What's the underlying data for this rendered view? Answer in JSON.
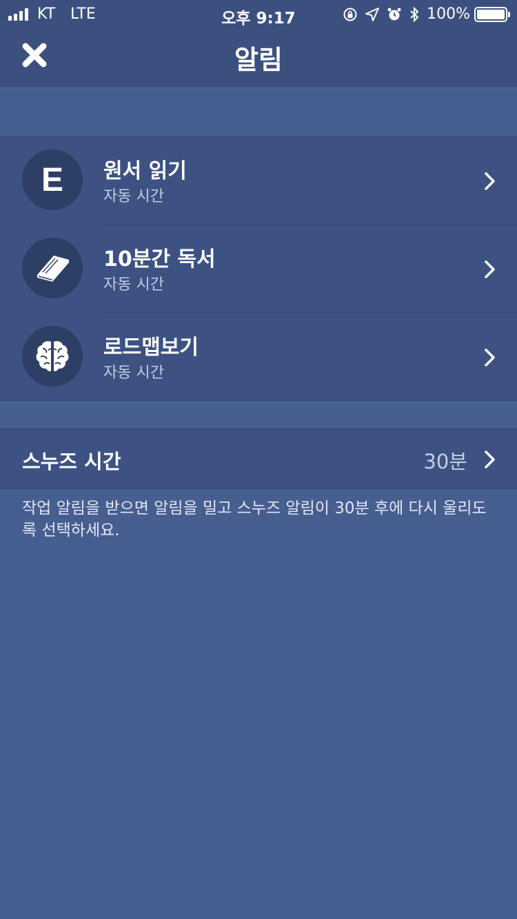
{
  "status_bar": {
    "carrier": "KT",
    "network": "LTE",
    "time": "오후 9:17",
    "battery": "100%"
  },
  "header": {
    "title": "알림"
  },
  "reminders": [
    {
      "title": "원서 읽기",
      "subtitle": "자동 시간",
      "icon": "letter-e-icon",
      "icon_text": "E"
    },
    {
      "title": "10분간 독서",
      "subtitle": "자동 시간",
      "icon": "book-icon"
    },
    {
      "title": "로드맵보기",
      "subtitle": "자동 시간",
      "icon": "brain-icon"
    }
  ],
  "snooze": {
    "label": "스누즈 시간",
    "value": "30분"
  },
  "note": "작업 알림을 받으면 알림을 밀고 스누즈 알림이 30분 후에 다시 울리도록 선택하세요.",
  "colors": {
    "background": "#475e91",
    "header": "#3c5080",
    "list": "#3d5282",
    "avatar": "#2e3f66"
  }
}
